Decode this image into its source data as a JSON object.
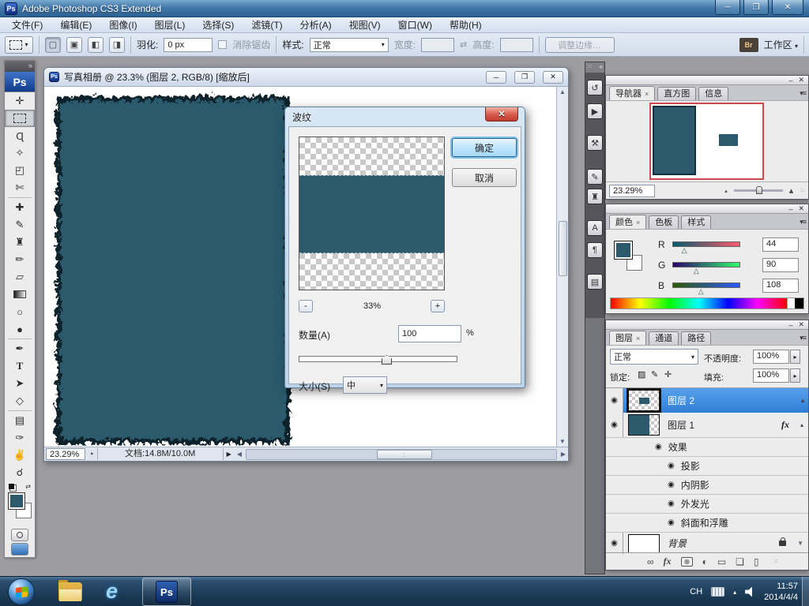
{
  "window": {
    "title": "Adobe Photoshop CS3 Extended",
    "logo": "Ps"
  },
  "menus": [
    "文件(F)",
    "编辑(E)",
    "图像(I)",
    "图层(L)",
    "选择(S)",
    "滤镜(T)",
    "分析(A)",
    "视图(V)",
    "窗口(W)",
    "帮助(H)"
  ],
  "options": {
    "feather_label": "羽化:",
    "feather_value": "0 px",
    "antialias_label": "消除锯齿",
    "style_label": "样式:",
    "style_value": "正常",
    "width_label": "宽度:",
    "height_label": "高度:",
    "refine_edge": "调整边缘…",
    "bridge_label": "Br",
    "workspace_label": "工作区"
  },
  "document": {
    "title": "写真相册 @ 23.3% (图层 2, RGB/8) [缩放后]",
    "zoom": "23.29%",
    "info": "文档:14.8M/10.0M"
  },
  "dialog": {
    "title": "波纹",
    "ok": "确定",
    "cancel": "取消",
    "zoom_out": "-",
    "zoom_value": "33%",
    "zoom_in": "+",
    "amount_label": "数量(A)",
    "amount_value": "100",
    "amount_unit": "%",
    "size_label": "大小(S)",
    "size_value": "中"
  },
  "navigator": {
    "tabs": [
      "导航器",
      "直方图",
      "信息"
    ],
    "zoom_value": "23.29%"
  },
  "color": {
    "tabs": [
      "颜色",
      "色板",
      "样式"
    ],
    "channels": [
      {
        "label": "R",
        "value": "44"
      },
      {
        "label": "G",
        "value": "90"
      },
      {
        "label": "B",
        "value": "108"
      }
    ],
    "foreground_hex": "#2C5A6C",
    "background_hex": "#FFFFFF"
  },
  "layers": {
    "tabs": [
      "图层",
      "通道",
      "路径"
    ],
    "blend_mode": "正常",
    "opacity_label": "不透明度:",
    "opacity_value": "100%",
    "lock_label": "锁定:",
    "fill_label": "填充:",
    "fill_value": "100%",
    "layer2_name": "图层 2",
    "layer1_name": "图层 1",
    "fx_label": "fx",
    "effects_header": "效果",
    "effects": [
      "投影",
      "内阴影",
      "外发光",
      "斜面和浮雕"
    ],
    "background_name": "背景"
  },
  "taskbar": {
    "lang": "CH",
    "time": "11:57",
    "date": "2014/4/4",
    "ps_label": "Ps"
  },
  "tools": [
    {
      "name": "move",
      "glyph": "✛"
    },
    {
      "name": "rectangular-marquee",
      "glyph": ""
    },
    {
      "name": "lasso",
      "glyph": "Ɋ"
    },
    {
      "name": "quick-selection",
      "glyph": "✧"
    },
    {
      "name": "crop",
      "glyph": "◰"
    },
    {
      "name": "slice",
      "glyph": "✄"
    },
    {
      "name": "healing-brush",
      "glyph": "✚"
    },
    {
      "name": "brush",
      "glyph": "✎"
    },
    {
      "name": "clone-stamp",
      "glyph": "♜"
    },
    {
      "name": "history-brush",
      "glyph": "✏"
    },
    {
      "name": "eraser",
      "glyph": "▱"
    },
    {
      "name": "gradient",
      "glyph": ""
    },
    {
      "name": "blur",
      "glyph": "○"
    },
    {
      "name": "dodge",
      "glyph": "●"
    },
    {
      "name": "pen",
      "glyph": "✒"
    },
    {
      "name": "type",
      "glyph": "T"
    },
    {
      "name": "path-selection",
      "glyph": "➤"
    },
    {
      "name": "shape",
      "glyph": "◇"
    },
    {
      "name": "notes",
      "glyph": "▤"
    },
    {
      "name": "eyedropper",
      "glyph": "✑"
    },
    {
      "name": "hand",
      "glyph": "✌"
    },
    {
      "name": "zoom",
      "glyph": "☌"
    }
  ],
  "dock": [
    {
      "name": "history",
      "glyph": "↺"
    },
    {
      "name": "actions",
      "glyph": "▶"
    },
    {
      "name": "tool-presets",
      "glyph": "⚒"
    },
    {
      "name": "brushes",
      "glyph": "✎"
    },
    {
      "name": "clone-source",
      "glyph": "♜"
    },
    {
      "name": "character",
      "glyph": "A"
    },
    {
      "name": "paragraph",
      "glyph": "¶"
    },
    {
      "name": "layer-comps",
      "glyph": "▤"
    }
  ],
  "icons": {
    "eye": "◉",
    "close": "✕",
    "minimize": "─",
    "restore": "❐",
    "dropdown": "▾",
    "spinner": "▸",
    "up": "▲",
    "down": "▼",
    "left": "◀",
    "right": "▶",
    "tri_small": "▴",
    "link": "∞",
    "adjustment": "◐",
    "folder": "▭",
    "new_layer": "❏",
    "trash": "▯",
    "swap": "⇄",
    "collapse_left": "«",
    "collapse_right": "»",
    "grip": "⁙",
    "pie": "◔",
    "pmin": "–",
    "sel_new": "▢",
    "sel_add": "▣",
    "sel_sub": "◧",
    "sel_int": "◨",
    "brush_small": "✎",
    "move_small": "✛",
    "checker_small": "▨",
    "x_tab": "×",
    "menu_lines": "≡"
  }
}
